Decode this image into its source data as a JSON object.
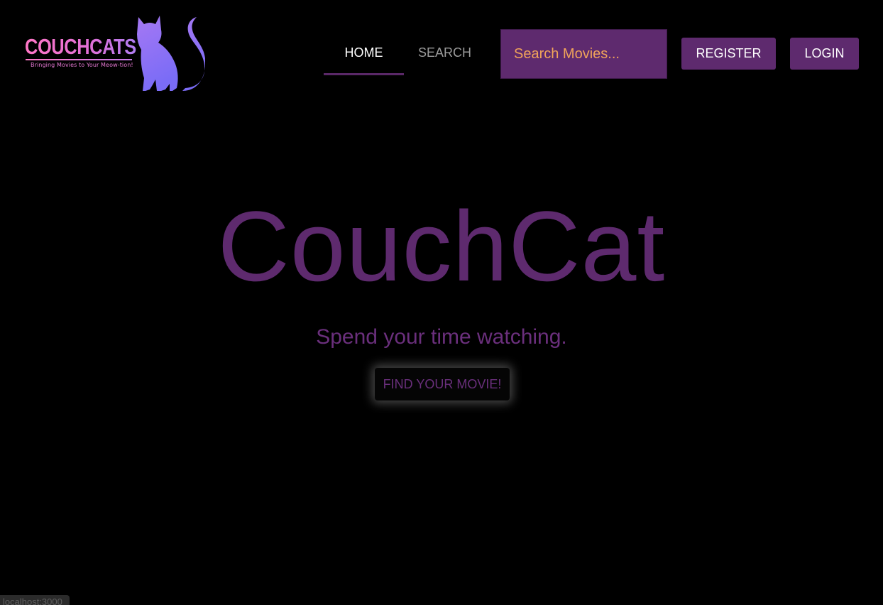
{
  "brand": {
    "name": "COUCHCATS",
    "tagline": "Bringing Movies to Your Meow-tion!",
    "logo_icon": "cat-silhouette-icon",
    "colors": {
      "wordmark_start": "#ff77c6",
      "wordmark_end": "#b07cf2",
      "cat_top": "#a678f4",
      "cat_bottom": "#7a6cf6"
    }
  },
  "nav": {
    "tabs": [
      {
        "label": "HOME",
        "active": true
      },
      {
        "label": "SEARCH",
        "active": false
      }
    ]
  },
  "search": {
    "placeholder": "Search Movies...",
    "value": ""
  },
  "header_buttons": {
    "register_label": "REGISTER",
    "login_label": "LOGIN"
  },
  "hero": {
    "title": "CouchCat",
    "subtitle": "Spend your time watching.",
    "cta_label": "FIND YOUR MOVIE!"
  },
  "status_bar": {
    "url": "localhost:3000"
  },
  "theme": {
    "background": "#000000",
    "accent": "#5e2a6e",
    "search_text": "#f0a35a",
    "muted_text": "#9b9b9b"
  }
}
